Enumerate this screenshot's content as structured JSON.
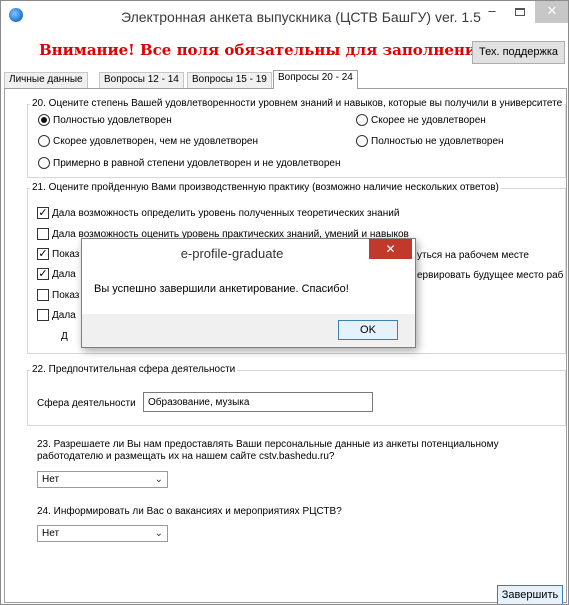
{
  "window": {
    "title": "Электронная анкета выпускника (ЦСТВ БашГУ) ver. 1.5",
    "icons": {
      "app": "app-globe-icon",
      "minimize": "minimize-icon",
      "maximize": "maximize-icon",
      "close": "close-icon"
    },
    "controls": {
      "minimize": "–",
      "close": "✕"
    }
  },
  "header": {
    "warning": "Внимание! Все поля обязательны для заполнения!!!",
    "support_button": "Тех. поддержка",
    "warning_color": "#e00000"
  },
  "tabs": [
    {
      "label": "Личные данные",
      "active": false
    },
    {
      "label": "Вопросы 12 - 14",
      "active": false
    },
    {
      "label": "Вопросы 15 - 19",
      "active": false
    },
    {
      "label": "Вопросы 20 - 24",
      "active": true
    }
  ],
  "q20": {
    "title": "20. Оцените степень Вашей удовлетворенности уровнем знаний и навыков, которые вы получили в университете",
    "options": [
      {
        "label": "Полностью удовлетворен",
        "selected": true
      },
      {
        "label": "Скорее не удовлетворен",
        "selected": false
      },
      {
        "label": "Скорее удовлетворен, чем не удовлетворен",
        "selected": false
      },
      {
        "label": "Полностью не удовлетворен",
        "selected": false
      },
      {
        "label": "Примерно в равной степени удовлетворен и не удовлетворен",
        "selected": false
      }
    ]
  },
  "q21": {
    "title": "21. Оцените пройденную Вами производственную практику (возможно наличие нескольких ответов)",
    "options": [
      {
        "label": "Дала возможность определить уровень полученных теоретических знаний",
        "checked": true
      },
      {
        "label": "Дала возможность оценить уровень практических знаний, умений и навыков",
        "checked": false
      },
      {
        "label": "Показ",
        "checked": true
      },
      {
        "label": "Дала",
        "checked": true
      },
      {
        "label": "Показ",
        "checked": false
      },
      {
        "label": "Дала",
        "checked": false
      }
    ],
    "right_fragments": [
      "уться на рабочем месте",
      "ервировать будущее место раб"
    ],
    "other_fragment": "Д"
  },
  "q22": {
    "title": "22. Предпочтительная сфера деятельности",
    "field_label": "Сфера деятельности",
    "field_value": "Образование, музыка"
  },
  "q23": {
    "text": "23. Разрешаете ли Вы нам предоставлять Ваши персональные данные из анкеты потенциальному работодателю и размещать их на нашем сайте cstv.bashedu.ru?",
    "selected": "Нет"
  },
  "q24": {
    "text": "24.  Информировать ли Вас о вакансиях и мероприятиях РЦСТВ?",
    "selected": "Нет"
  },
  "finish_button": "Завершить",
  "dialog": {
    "title": "e-profile-graduate",
    "message": "Вы успешно завершили анкетирование. Спасибо!",
    "ok": "OK",
    "close": "✕"
  }
}
